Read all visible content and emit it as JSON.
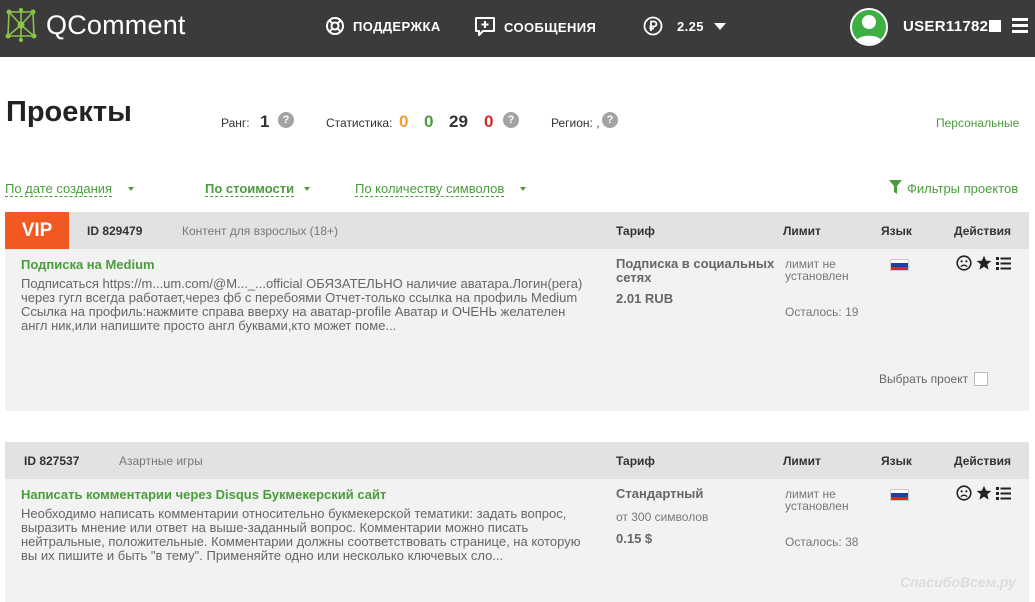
{
  "header": {
    "logo_text": "QComment",
    "support_label": "ПОДДЕРЖКА",
    "messages_label": "СООБЩЕНИЯ",
    "balance": "2.25",
    "username": "USER11782",
    "accent": "#4a9d3c"
  },
  "page": {
    "title": "Проекты",
    "rank_label": "Ранг:",
    "rank_value": "1",
    "stats_label": "Статистика:",
    "stats_values": [
      "0",
      "0",
      "29",
      "0"
    ],
    "region_label": "Регион: ,",
    "personal_link": "Персональные"
  },
  "sort": {
    "by_date": "По дате создания",
    "by_price": "По стоимости",
    "by_chars": "По количеству символов",
    "filters": "Фильтры проектов"
  },
  "columns": {
    "tariff": "Тариф",
    "limit": "Лимит",
    "language": "Язык",
    "actions": "Действия"
  },
  "projects": [
    {
      "vip": "VIP",
      "id": "ID 829479",
      "category": "Контент для взрослых (18+)",
      "title": "Подписка на Medium",
      "description": "Подписаться https://m...um.com/@M..._...official ОБЯЗАТЕЛЬНО наличие аватара.Логин(рега) через гугл всегда работает,через фб с перебоями Отчет-только ссылка на профиль Medium Ссылка на профиль:нажмите справа вверху на аватар-profile Аватар и ОЧЕНЬ желателен англ ник,или напишите просто англ буквами,кто может поме...",
      "tariff_name": "Подписка в социальных сетях",
      "tariff_sub": "",
      "price": "2.01 RUB",
      "limit": "лимит не установлен",
      "remaining": "Осталось: 19",
      "select_label": "Выбрать проект"
    },
    {
      "vip": "",
      "id": "ID 827537",
      "category": "Азартные игры",
      "title": "Написать комментарии через Disqus Букмекерский сайт",
      "description": "Необходимо написать комментарии относительно букмекерской тематики: задать вопрос, выразить мнение или ответ на выше-заданный вопрос. Комментарии можно писать нейтральные, положительные. Комментарии должны соответствовать странице, на которую вы их пишите и быть \"в тему\". Применяйте одно или несколько ключевых сло...",
      "tariff_name": "Стандартный",
      "tariff_sub": "от 300 символов",
      "price": "0.15 $",
      "limit": "лимит не установлен",
      "remaining": "Осталось: 38",
      "select_label": ""
    }
  ],
  "watermark": "СпасибоВсем.ру"
}
